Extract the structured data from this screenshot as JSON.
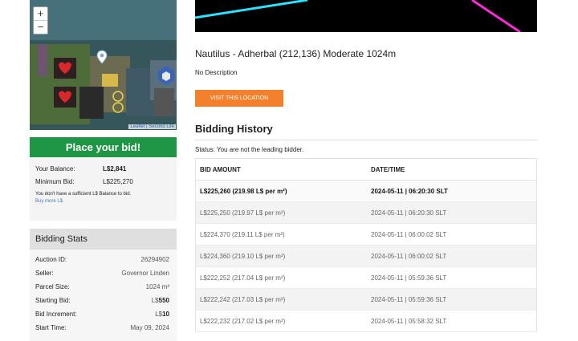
{
  "map": {
    "zoom_in": "+",
    "zoom_out": "−",
    "credit_a": "Leaflet",
    "credit_sep": " | ",
    "credit_b": "Second Life"
  },
  "bid_button": "Place your bid!",
  "balance": {
    "your_balance_label": "Your Balance:",
    "your_balance_value": "L$2,841",
    "min_bid_label": "Minimum Bid:",
    "min_bid_value": "L$225,270",
    "insufficient": "You don't have a sufficient L$ Balance to bid.",
    "buy_more": "Buy more L$."
  },
  "stats": {
    "heading": "Bidding Stats",
    "rows": [
      {
        "label": "Auction ID:",
        "value": "26294902"
      },
      {
        "label": "Seller:",
        "value": "Governor Linden"
      },
      {
        "label": "Parcel Size:",
        "value": "1024 m²"
      },
      {
        "label": "Starting Bid:",
        "prefix": "L$",
        "value": "550"
      },
      {
        "label": "Bid Increment:",
        "prefix": "L$",
        "value": "10"
      },
      {
        "label": "Start Time:",
        "value": "May 09, 2024"
      }
    ]
  },
  "listing": {
    "title": "Nautilus - Adherbal (212,136) Moderate 1024m",
    "description": "No Description",
    "visit_button": "VISIT THIS LOCATION"
  },
  "history": {
    "heading": "Bidding History",
    "status": "Status: You are not the leading bidder.",
    "columns": [
      "BID AMOUNT",
      "DATE/TIME"
    ],
    "rows": [
      {
        "amount": "L$225,260 (219.98 L$ per m²)",
        "time": "2024-05-11 | 06:20:30 SLT"
      },
      {
        "amount": "L$225,250 (219.97 L$ per m²)",
        "time": "2024-05-11 | 06:20:30 SLT"
      },
      {
        "amount": "L$224,370 (219.11 L$ per m²)",
        "time": "2024-05-11 | 06:00:02 SLT"
      },
      {
        "amount": "L$224,360 (219.10 L$ per m²)",
        "time": "2024-05-11 | 06:00:02 SLT"
      },
      {
        "amount": "L$222,252 (217.04 L$ per m²)",
        "time": "2024-05-11 | 05:59:36 SLT"
      },
      {
        "amount": "L$222,242 (217.03 L$ per m²)",
        "time": "2024-05-11 | 05:59:36 SLT"
      },
      {
        "amount": "L$222,232 (217.02 L$ per m²)",
        "time": "2024-05-11 | 05:58:32 SLT"
      }
    ]
  },
  "colors": {
    "bid_green": "#1e9645",
    "visit_orange": "#f5802b",
    "neon_cyan": "#29e3ff",
    "neon_magenta": "#ff2bd6"
  }
}
